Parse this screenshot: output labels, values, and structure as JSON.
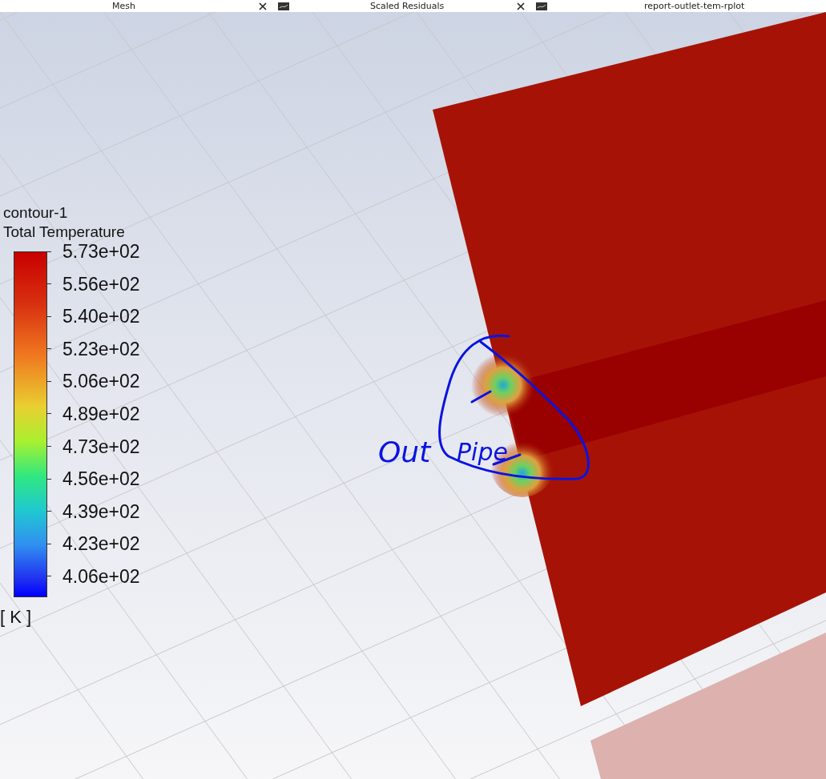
{
  "tabs": [
    {
      "label": "Mesh",
      "closable": true
    },
    {
      "label": "Scaled Residuals",
      "closable": true
    },
    {
      "label": "report-outlet-tem-rplot",
      "closable": false
    }
  ],
  "legend": {
    "title": "contour-1",
    "variable": "Total Temperature",
    "ticks": [
      "5.73e+02",
      "5.56e+02",
      "5.40e+02",
      "5.23e+02",
      "5.06e+02",
      "4.89e+02",
      "4.73e+02",
      "4.56e+02",
      "4.39e+02",
      "4.23e+02",
      "4.06e+02"
    ],
    "unit": "[ K ]"
  },
  "annotations": [
    {
      "text": "Out"
    },
    {
      "text": "Pipe"
    }
  ]
}
